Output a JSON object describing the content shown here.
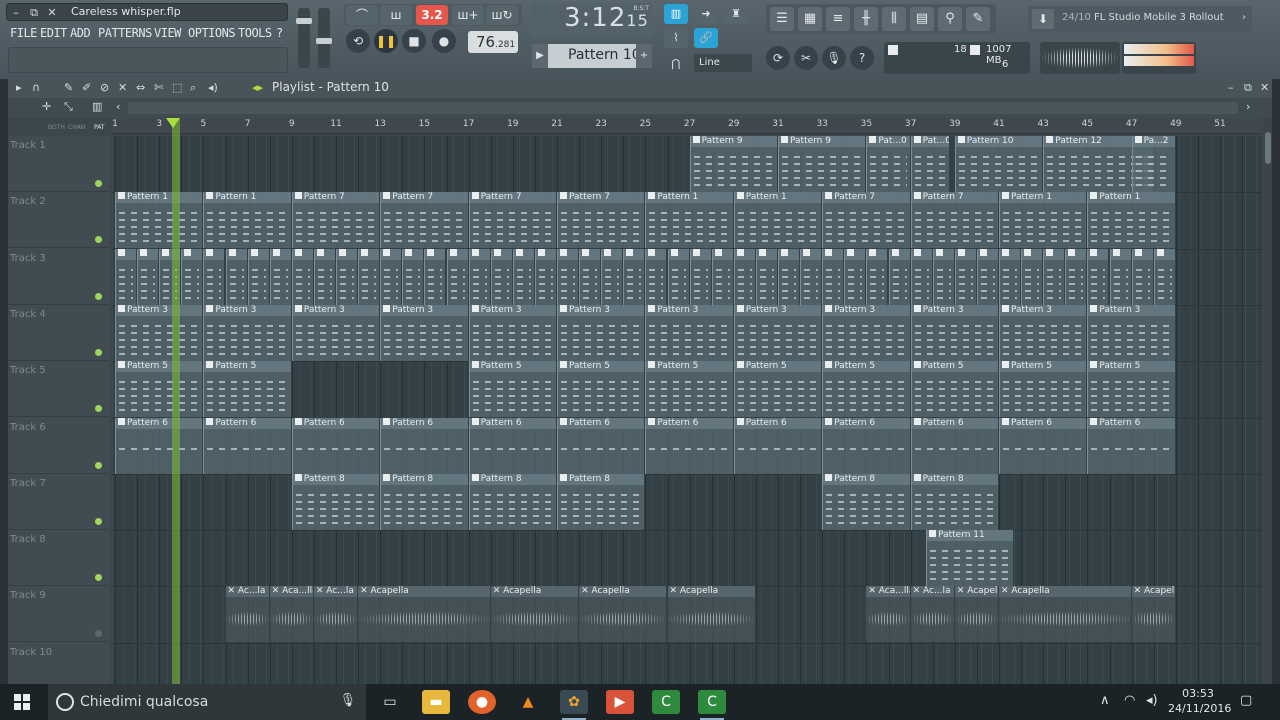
{
  "window": {
    "title": "Careless whisper.flp",
    "controls": [
      "–",
      "⧉",
      "✕"
    ]
  },
  "menu": [
    "FILE",
    "EDIT",
    "ADD",
    "PATTERNS",
    "VIEW",
    "OPTIONS",
    "TOOLS",
    "?"
  ],
  "transport": {
    "pat_song_label": "3.2",
    "time": "3:12",
    "time_small": "15",
    "time_unit": "B:S:T",
    "tempo": "76",
    "tempo_small": ".281",
    "pattern": "Pattern 10",
    "snap": "Line"
  },
  "performance": {
    "cpu_voices": "18",
    "memory": "1007 MB",
    "polyphony": "6"
  },
  "news": {
    "count": "24/10",
    "text": "FL Studio Mobile 3 Rollout"
  },
  "playlist": {
    "title": "Playlist - Pattern 10",
    "ruler_ticks": [
      "1",
      "3",
      "5",
      "7",
      "9",
      "11",
      "13",
      "15",
      "17",
      "19",
      "21",
      "23",
      "25",
      "27",
      "29",
      "31",
      "33",
      "35",
      "37",
      "39",
      "41",
      "43",
      "45",
      "47",
      "49",
      "51"
    ],
    "ruler_labels": [
      "BOTH",
      "CHAN",
      "PAT"
    ],
    "tracks": [
      {
        "name": "Track 1",
        "dot": true
      },
      {
        "name": "Track 2",
        "dot": true
      },
      {
        "name": "Track 3",
        "dot": true
      },
      {
        "name": "Track 4",
        "dot": true
      },
      {
        "name": "Track 5",
        "dot": true
      },
      {
        "name": "Track 6",
        "dot": true
      },
      {
        "name": "Track 7",
        "dot": true
      },
      {
        "name": "Track 8",
        "dot": true
      },
      {
        "name": "Track 9",
        "dot": false
      },
      {
        "name": "Track 10",
        "dot": false
      }
    ],
    "clips": [
      {
        "track": 0,
        "start": 27,
        "len": 4,
        "label": "Pattern 9"
      },
      {
        "track": 0,
        "start": 31,
        "len": 4,
        "label": "Pattern 9"
      },
      {
        "track": 0,
        "start": 35,
        "len": 2,
        "label": "Pat...0"
      },
      {
        "track": 0,
        "start": 37,
        "len": 1.8,
        "label": "Pat...0"
      },
      {
        "track": 0,
        "start": 39,
        "len": 4,
        "label": "Pattern 10"
      },
      {
        "track": 0,
        "start": 43,
        "len": 5,
        "label": "Pattern 12"
      },
      {
        "track": 0,
        "start": 47,
        "len": 2,
        "label": "Pa...2"
      },
      {
        "track": 1,
        "start": 1,
        "len": 4,
        "label": "Pattern 1"
      },
      {
        "track": 1,
        "start": 5,
        "len": 4,
        "label": "Pattern 1"
      },
      {
        "track": 1,
        "start": 9,
        "len": 4,
        "label": "Pattern 7"
      },
      {
        "track": 1,
        "start": 13,
        "len": 4,
        "label": "Pattern 7"
      },
      {
        "track": 1,
        "start": 17,
        "len": 4,
        "label": "Pattern 7"
      },
      {
        "track": 1,
        "start": 21,
        "len": 4,
        "label": "Pattern 7"
      },
      {
        "track": 1,
        "start": 25,
        "len": 4,
        "label": "Pattern 1"
      },
      {
        "track": 1,
        "start": 29,
        "len": 4,
        "label": "Pattern 1"
      },
      {
        "track": 1,
        "start": 33,
        "len": 4,
        "label": "Pattern 7"
      },
      {
        "track": 1,
        "start": 37,
        "len": 4,
        "label": "Pattern 7"
      },
      {
        "track": 1,
        "start": 41,
        "len": 4,
        "label": "Pattern 1"
      },
      {
        "track": 1,
        "start": 45,
        "len": 4,
        "label": "Pattern 1"
      },
      {
        "track": 3,
        "start": 1,
        "len": 4,
        "label": "Pattern 3"
      },
      {
        "track": 3,
        "start": 5,
        "len": 4,
        "label": "Pattern 3"
      },
      {
        "track": 3,
        "start": 9,
        "len": 4,
        "label": "Pattern 3"
      },
      {
        "track": 3,
        "start": 13,
        "len": 4,
        "label": "Pattern 3"
      },
      {
        "track": 3,
        "start": 17,
        "len": 4,
        "label": "Pattern 3"
      },
      {
        "track": 3,
        "start": 21,
        "len": 4,
        "label": "Pattern 3"
      },
      {
        "track": 3,
        "start": 25,
        "len": 4,
        "label": "Pattern 3"
      },
      {
        "track": 3,
        "start": 29,
        "len": 4,
        "label": "Pattern 3"
      },
      {
        "track": 3,
        "start": 33,
        "len": 4,
        "label": "Pattern 3"
      },
      {
        "track": 3,
        "start": 37,
        "len": 4,
        "label": "Pattern 3"
      },
      {
        "track": 3,
        "start": 41,
        "len": 4,
        "label": "Pattern 3"
      },
      {
        "track": 3,
        "start": 45,
        "len": 4,
        "label": "Pattern 3"
      },
      {
        "track": 4,
        "start": 1,
        "len": 4,
        "label": "Pattern 5"
      },
      {
        "track": 4,
        "start": 5,
        "len": 4,
        "label": "Pattern 5"
      },
      {
        "track": 4,
        "start": 17,
        "len": 4,
        "label": "Pattern 5"
      },
      {
        "track": 4,
        "start": 21,
        "len": 4,
        "label": "Pattern 5"
      },
      {
        "track": 4,
        "start": 25,
        "len": 4,
        "label": "Pattern 5"
      },
      {
        "track": 4,
        "start": 29,
        "len": 4,
        "label": "Pattern 5"
      },
      {
        "track": 4,
        "start": 33,
        "len": 4,
        "label": "Pattern 5"
      },
      {
        "track": 4,
        "start": 37,
        "len": 4,
        "label": "Pattern 5"
      },
      {
        "track": 4,
        "start": 41,
        "len": 4,
        "label": "Pattern 5"
      },
      {
        "track": 4,
        "start": 45,
        "len": 4,
        "label": "Pattern 5"
      },
      {
        "track": 5,
        "start": 1,
        "len": 4,
        "label": "Pattern 6"
      },
      {
        "track": 5,
        "start": 5,
        "len": 4,
        "label": "Pattern 6"
      },
      {
        "track": 5,
        "start": 9,
        "len": 4,
        "label": "Pattern 6"
      },
      {
        "track": 5,
        "start": 13,
        "len": 4,
        "label": "Pattern 6"
      },
      {
        "track": 5,
        "start": 17,
        "len": 4,
        "label": "Pattern 6"
      },
      {
        "track": 5,
        "start": 21,
        "len": 4,
        "label": "Pattern 6"
      },
      {
        "track": 5,
        "start": 25,
        "len": 4,
        "label": "Pattern 6"
      },
      {
        "track": 5,
        "start": 29,
        "len": 4,
        "label": "Pattern 6"
      },
      {
        "track": 5,
        "start": 33,
        "len": 4,
        "label": "Pattern 6"
      },
      {
        "track": 5,
        "start": 37,
        "len": 4,
        "label": "Pattern 6"
      },
      {
        "track": 5,
        "start": 41,
        "len": 4,
        "label": "Pattern 6"
      },
      {
        "track": 5,
        "start": 45,
        "len": 4,
        "label": "Pattern 6"
      },
      {
        "track": 6,
        "start": 9,
        "len": 4,
        "label": "Pattern 8"
      },
      {
        "track": 6,
        "start": 13,
        "len": 4,
        "label": "Pattern 8"
      },
      {
        "track": 6,
        "start": 17,
        "len": 4,
        "label": "Pattern 8"
      },
      {
        "track": 6,
        "start": 21,
        "len": 4,
        "label": "Pattern 8"
      },
      {
        "track": 6,
        "start": 33,
        "len": 4,
        "label": "Pattern 8"
      },
      {
        "track": 6,
        "start": 37,
        "len": 4,
        "label": "Pattern 8"
      },
      {
        "track": 7,
        "start": 37.7,
        "len": 4,
        "label": "Pattern 11"
      }
    ],
    "audio_clips": [
      {
        "track": 8,
        "start": 6,
        "len": 2,
        "label": "Ac...la"
      },
      {
        "track": 8,
        "start": 8,
        "len": 2,
        "label": "Aca...lla"
      },
      {
        "track": 8,
        "start": 10,
        "len": 2,
        "label": "Ac...la"
      },
      {
        "track": 8,
        "start": 12,
        "len": 6,
        "label": "Acapella"
      },
      {
        "track": 8,
        "start": 18,
        "len": 4,
        "label": "Acapella"
      },
      {
        "track": 8,
        "start": 22,
        "len": 4,
        "label": "Acapella"
      },
      {
        "track": 8,
        "start": 26,
        "len": 4,
        "label": "Acapella"
      },
      {
        "track": 8,
        "start": 35,
        "len": 2,
        "label": "Aca...lla"
      },
      {
        "track": 8,
        "start": 37,
        "len": 2,
        "label": "Ac...la"
      },
      {
        "track": 8,
        "start": 39,
        "len": 2,
        "label": "Acapel"
      },
      {
        "track": 8,
        "start": 41,
        "len": 6,
        "label": "Acapella"
      },
      {
        "track": 8,
        "start": 47,
        "len": 2,
        "label": "Acapella"
      }
    ]
  },
  "taskbar": {
    "search_placeholder": "Chiedimi qualcosa",
    "time": "03:53",
    "date": "24/11/2016"
  },
  "colors": {
    "accent_green": "#a8e03c",
    "accent_red": "#e4574a",
    "accent_blue": "#2aa3d6"
  }
}
